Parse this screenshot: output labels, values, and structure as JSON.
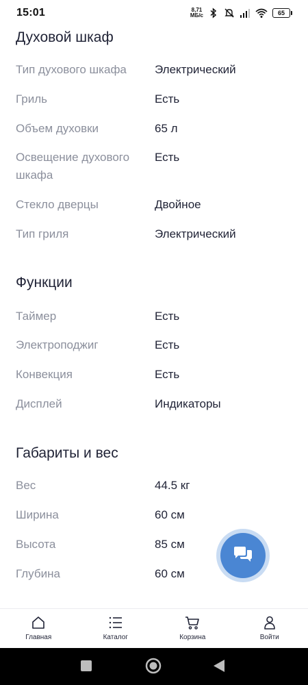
{
  "status_bar": {
    "time": "15:01",
    "net_speed_value": "8,71",
    "net_speed_unit": "МБ/с",
    "battery": "65",
    "icons": [
      "bluetooth-icon",
      "dnd-off-icon",
      "signal-icon",
      "wifi-icon",
      "battery-icon"
    ]
  },
  "sections": [
    {
      "title": "Духовой шкаф",
      "rows": [
        {
          "label": "Тип духового шкафа",
          "value": "Электрический"
        },
        {
          "label": "Гриль",
          "value": "Есть"
        },
        {
          "label": "Объем духовки",
          "value": "65 л"
        },
        {
          "label": "Освещение духового шкафа",
          "value": "Есть"
        },
        {
          "label": "Стекло дверцы",
          "value": "Двойное"
        },
        {
          "label": "Тип гриля",
          "value": "Электрический"
        }
      ]
    },
    {
      "title": "Функции",
      "rows": [
        {
          "label": "Таймер",
          "value": "Есть"
        },
        {
          "label": "Электроподжиг",
          "value": "Есть"
        },
        {
          "label": "Конвекция",
          "value": "Есть"
        },
        {
          "label": "Дисплей",
          "value": "Индикаторы"
        }
      ]
    },
    {
      "title": "Габариты и вес",
      "rows": [
        {
          "label": "Вес",
          "value": "44.5 кг"
        },
        {
          "label": "Ширина",
          "value": "60 см"
        },
        {
          "label": "Высота",
          "value": "85 см"
        },
        {
          "label": "Глубина",
          "value": "60 см"
        }
      ]
    }
  ],
  "chat_button": {
    "icon": "chat-icon",
    "color": "#4a86d3"
  },
  "bottom_nav": [
    {
      "label": "Главная",
      "icon": "home-icon"
    },
    {
      "label": "Каталог",
      "icon": "catalog-list-icon"
    },
    {
      "label": "Корзина",
      "icon": "cart-icon"
    },
    {
      "label": "Войти",
      "icon": "user-icon"
    }
  ],
  "system_nav": [
    "recents-square-icon",
    "home-circle-icon",
    "back-triangle-icon"
  ]
}
